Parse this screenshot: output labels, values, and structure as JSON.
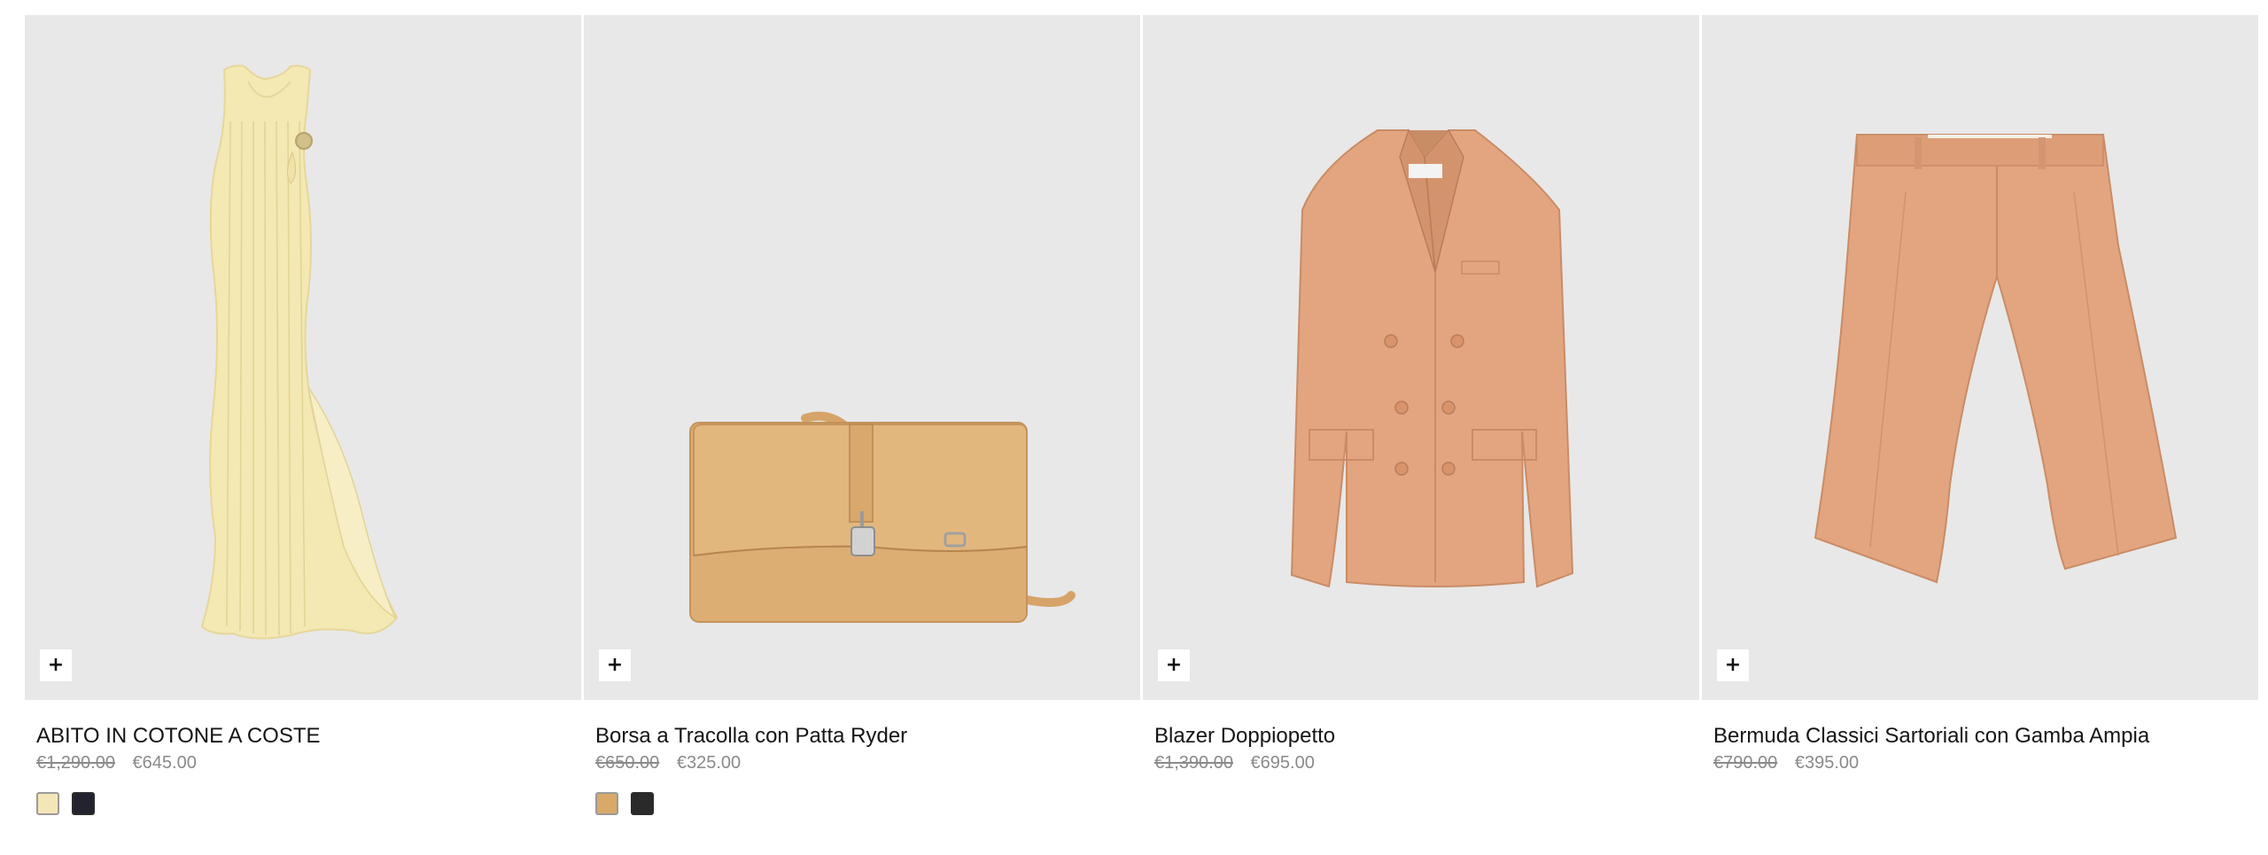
{
  "colors": {
    "tile_bg": "#e8e8e8",
    "text": "#151515",
    "muted": "#8a8a8a"
  },
  "products": [
    {
      "name": "ABITO IN COTONE A COSTE",
      "old_price": "€1,290.00",
      "price": "€645.00",
      "add_label": "+",
      "image": "yellow-ribbed-dress",
      "swatches": [
        {
          "color": "#f3e7b8"
        },
        {
          "color": "#22232f"
        }
      ]
    },
    {
      "name": "Borsa a Tracolla con Patta Ryder",
      "old_price": "€650.00",
      "price": "€325.00",
      "add_label": "+",
      "image": "tan-crossbody-bag",
      "swatches": [
        {
          "color": "#d9a96a"
        },
        {
          "color": "#2a2a2a"
        }
      ]
    },
    {
      "name": "Blazer Doppiopetto",
      "old_price": "€1,390.00",
      "price": "€695.00",
      "add_label": "+",
      "image": "peach-double-breasted-blazer",
      "swatches": []
    },
    {
      "name": "Bermuda Classici Sartoriali con Gamba Ampia",
      "old_price": "€790.00",
      "price": "€395.00",
      "add_label": "+",
      "image": "peach-wide-leg-bermuda",
      "swatches": []
    }
  ]
}
